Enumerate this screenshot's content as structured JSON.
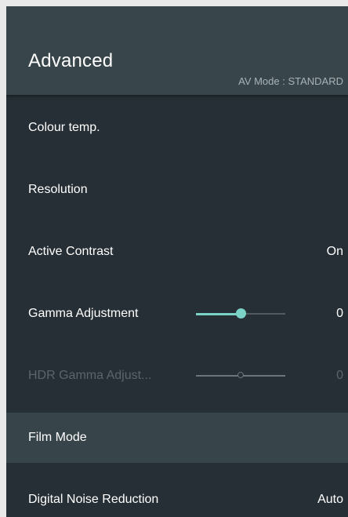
{
  "header": {
    "title": "Advanced",
    "av_mode": "AV Mode : STANDARD"
  },
  "menu": {
    "items": [
      {
        "label": "Colour temp.",
        "value": ""
      },
      {
        "label": "Resolution",
        "value": ""
      },
      {
        "label": "Active Contrast",
        "value": "On"
      },
      {
        "label": "Gamma Adjustment",
        "value": "0",
        "slider_position": 0.5
      },
      {
        "label": "HDR Gamma Adjust...",
        "value": "0",
        "slider_position": 0.5,
        "disabled": true
      },
      {
        "label": "Film Mode",
        "value": "",
        "focused": true
      },
      {
        "label": "Digital Noise Reduction",
        "value": "Auto"
      }
    ]
  },
  "colors": {
    "background": "#262f35",
    "header": "#38454a",
    "highlight": "#37444a",
    "accent": "#7bd2c6",
    "disabled_text": "#5a656b"
  }
}
